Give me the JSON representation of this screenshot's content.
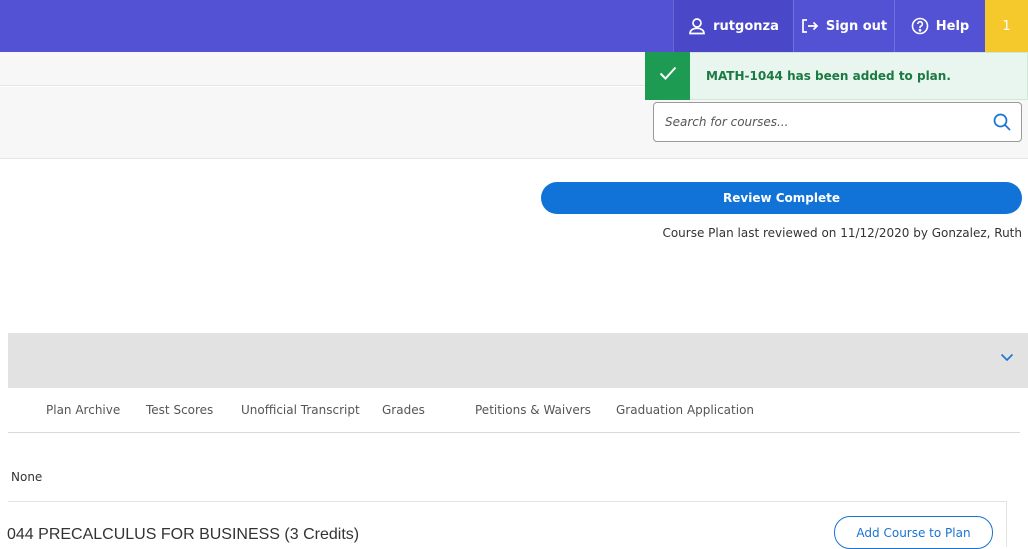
{
  "header": {
    "username": "rutgonza",
    "sign_out_label": "Sign out",
    "help_label": "Help",
    "notification_count": "1",
    "colors": {
      "bar": "#5452d4",
      "notification": "#f5c92b"
    }
  },
  "toast": {
    "message": "MATH-1044 has been added to plan.",
    "icon": "checkmark-icon",
    "color": "#1e9b52"
  },
  "search": {
    "placeholder": "Search for courses...",
    "icon": "search-icon"
  },
  "review": {
    "button_label": "Review Complete",
    "last_reviewed": "Course Plan last reviewed on 11/12/2020 by Gonzalez, Ruth"
  },
  "tabs": [
    {
      "label": "Plan Archive"
    },
    {
      "label": "Test Scores"
    },
    {
      "label": "Unofficial Transcript"
    },
    {
      "label": "Grades"
    },
    {
      "label": "Petitions & Waivers"
    },
    {
      "label": "Graduation Application"
    }
  ],
  "content": {
    "none_label": "None",
    "course_title": "044 PRECALCULUS FOR BUSINESS (3 Credits)",
    "add_button_label": "Add Course to Plan"
  }
}
